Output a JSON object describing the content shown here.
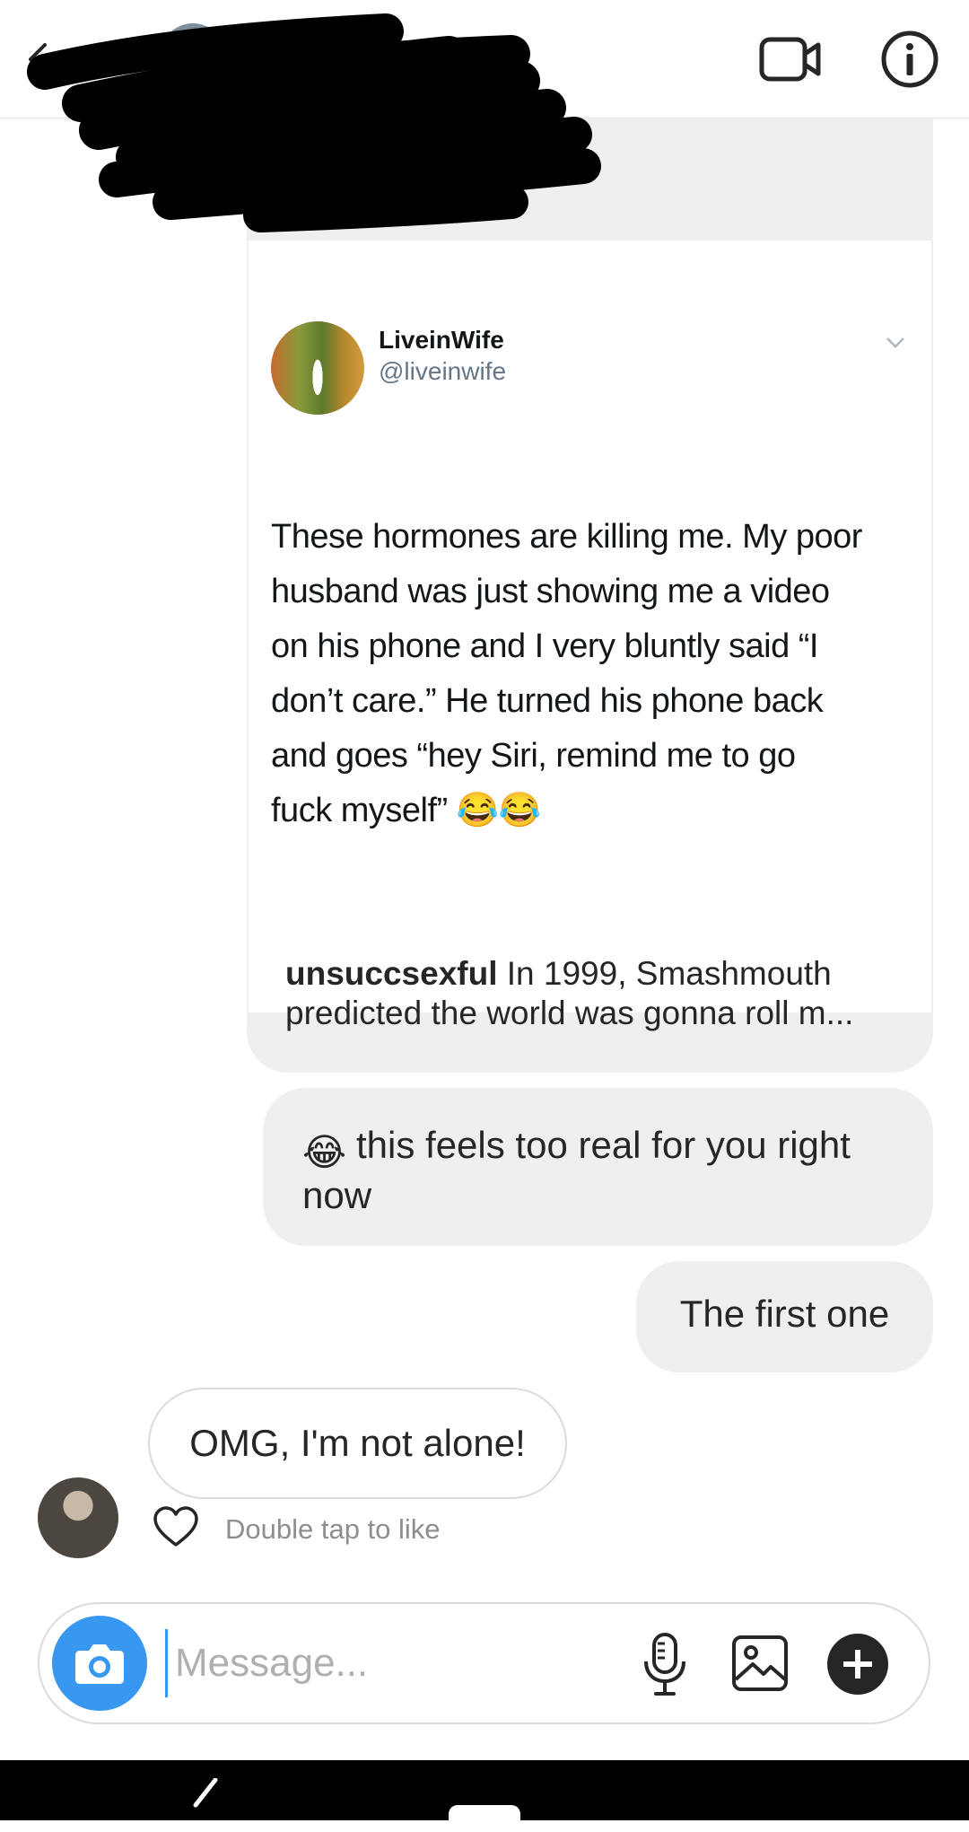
{
  "header": {
    "back_icon": "arrow-left-icon",
    "video_icon": "video-camera-icon",
    "info_icon": "info-circle-icon"
  },
  "shared_post": {
    "tweet": {
      "name": "LiveinWife",
      "handle": "@liveinwife",
      "text": "These hormones are killing me. My poor\nhusband was just showing me a video\non his phone and I very bluntly said “I\ndon’t care.” He turned his phone back\nand goes “hey Siri, remind me to go\nfuck myself” 😂😂"
    },
    "caption_user": "unsuccsexful",
    "caption_text": "In 1999, Smashmouth predicted the world was gonna roll m..."
  },
  "messages": [
    {
      "direction": "outgoing",
      "emoji": "😂",
      "text": "this feels too real for you right now"
    },
    {
      "direction": "outgoing",
      "text": "The first one"
    },
    {
      "direction": "incoming",
      "text": "OMG, I'm not alone!"
    }
  ],
  "like_hint": "Double tap to like",
  "composer": {
    "placeholder": "Message...",
    "camera_icon": "camera-icon",
    "mic_icon": "microphone-icon",
    "gallery_icon": "image-icon",
    "plus_icon": "plus-icon"
  },
  "colors": {
    "accent": "#3897f0",
    "bubble_bg": "#efefef",
    "text": "#262626",
    "muted": "#8e8e8e"
  }
}
